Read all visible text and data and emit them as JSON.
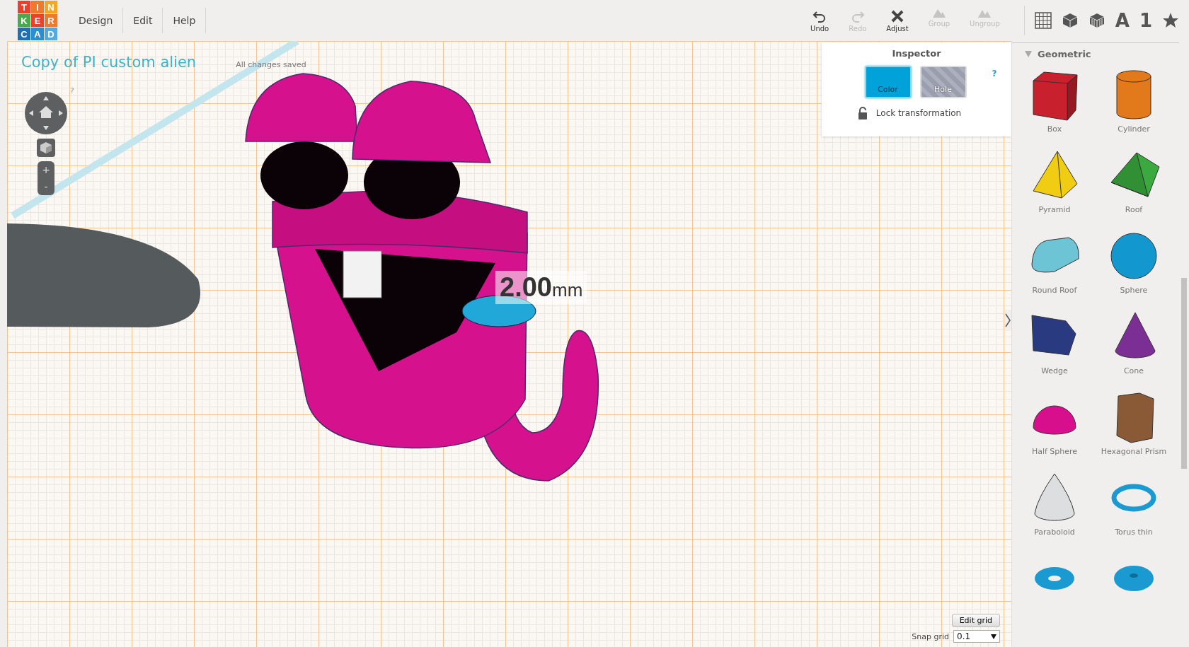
{
  "logo": {
    "letters": [
      {
        "char": "T",
        "color": "#e8412c"
      },
      {
        "char": "I",
        "color": "#ee7a30"
      },
      {
        "char": "N",
        "color": "#f5a623"
      },
      {
        "char": "K",
        "color": "#4aa94a"
      },
      {
        "char": "E",
        "color": "#e8412c"
      },
      {
        "char": "R",
        "color": "#ee7a30"
      },
      {
        "char": "C",
        "color": "#1f6fb5"
      },
      {
        "char": "A",
        "color": "#2a8fd0"
      },
      {
        "char": "D",
        "color": "#53a9e0"
      }
    ]
  },
  "menu": [
    {
      "label": "Design"
    },
    {
      "label": "Edit"
    },
    {
      "label": "Help"
    }
  ],
  "toolbar": [
    {
      "kind": "undo",
      "label": "Undo",
      "disabled": false
    },
    {
      "kind": "redo",
      "label": "Redo",
      "disabled": true
    },
    {
      "kind": "adjust",
      "label": "Adjust",
      "disabled": false
    },
    {
      "kind": "group",
      "label": "Group",
      "disabled": true
    },
    {
      "kind": "ungroup",
      "label": "Ungroup",
      "disabled": true
    }
  ],
  "view_tools": [
    {
      "kind": "grid"
    },
    {
      "kind": "cube"
    },
    {
      "kind": "striped-cube"
    },
    {
      "kind": "text",
      "char": "A"
    },
    {
      "kind": "text",
      "char": "1"
    },
    {
      "kind": "star"
    }
  ],
  "design": {
    "title": "Copy of PI custom alien",
    "save_status": "All changes saved"
  },
  "nav": {
    "help": "?",
    "zoom_in": "+",
    "zoom_out": "-"
  },
  "dimension": {
    "value": "2.00",
    "unit": "mm"
  },
  "inspector": {
    "title": "Inspector",
    "modes": [
      {
        "kind": "color",
        "label": "Color",
        "selected": true
      },
      {
        "kind": "hole",
        "label": "Hole",
        "selected": false
      }
    ],
    "help": "?",
    "lock_label": "Lock transformation"
  },
  "grid_controls": {
    "edit_button": "Edit grid",
    "snap_label": "Snap grid",
    "snap_value": "0.1"
  },
  "library": {
    "section": "Geometric",
    "expanded": true,
    "shapes": [
      {
        "kind": "box",
        "label": "Box",
        "color": "#c8202c"
      },
      {
        "kind": "cylinder",
        "label": "Cylinder",
        "color": "#e27a1c"
      },
      {
        "kind": "pyramid",
        "label": "Pyramid",
        "color": "#f0cc12"
      },
      {
        "kind": "roof",
        "label": "Roof",
        "color": "#3aa93e"
      },
      {
        "kind": "round-roof",
        "label": "Round Roof",
        "color": "#6cc4d4"
      },
      {
        "kind": "sphere",
        "label": "Sphere",
        "color": "#1298cf"
      },
      {
        "kind": "wedge",
        "label": "Wedge",
        "color": "#2a3a80"
      },
      {
        "kind": "cone",
        "label": "Cone",
        "color": "#7b2f95"
      },
      {
        "kind": "half-sphere",
        "label": "Half Sphere",
        "color": "#d80f8c"
      },
      {
        "kind": "hex-prism",
        "label": "Hexagonal Prism",
        "color": "#8a5a36"
      },
      {
        "kind": "paraboloid",
        "label": "Paraboloid",
        "color": "#dcdedf"
      },
      {
        "kind": "torus-thin",
        "label": "Torus thin",
        "color": "#1a9ad0"
      },
      {
        "kind": "torus"
      },
      {
        "kind": "torus-thick"
      }
    ]
  }
}
